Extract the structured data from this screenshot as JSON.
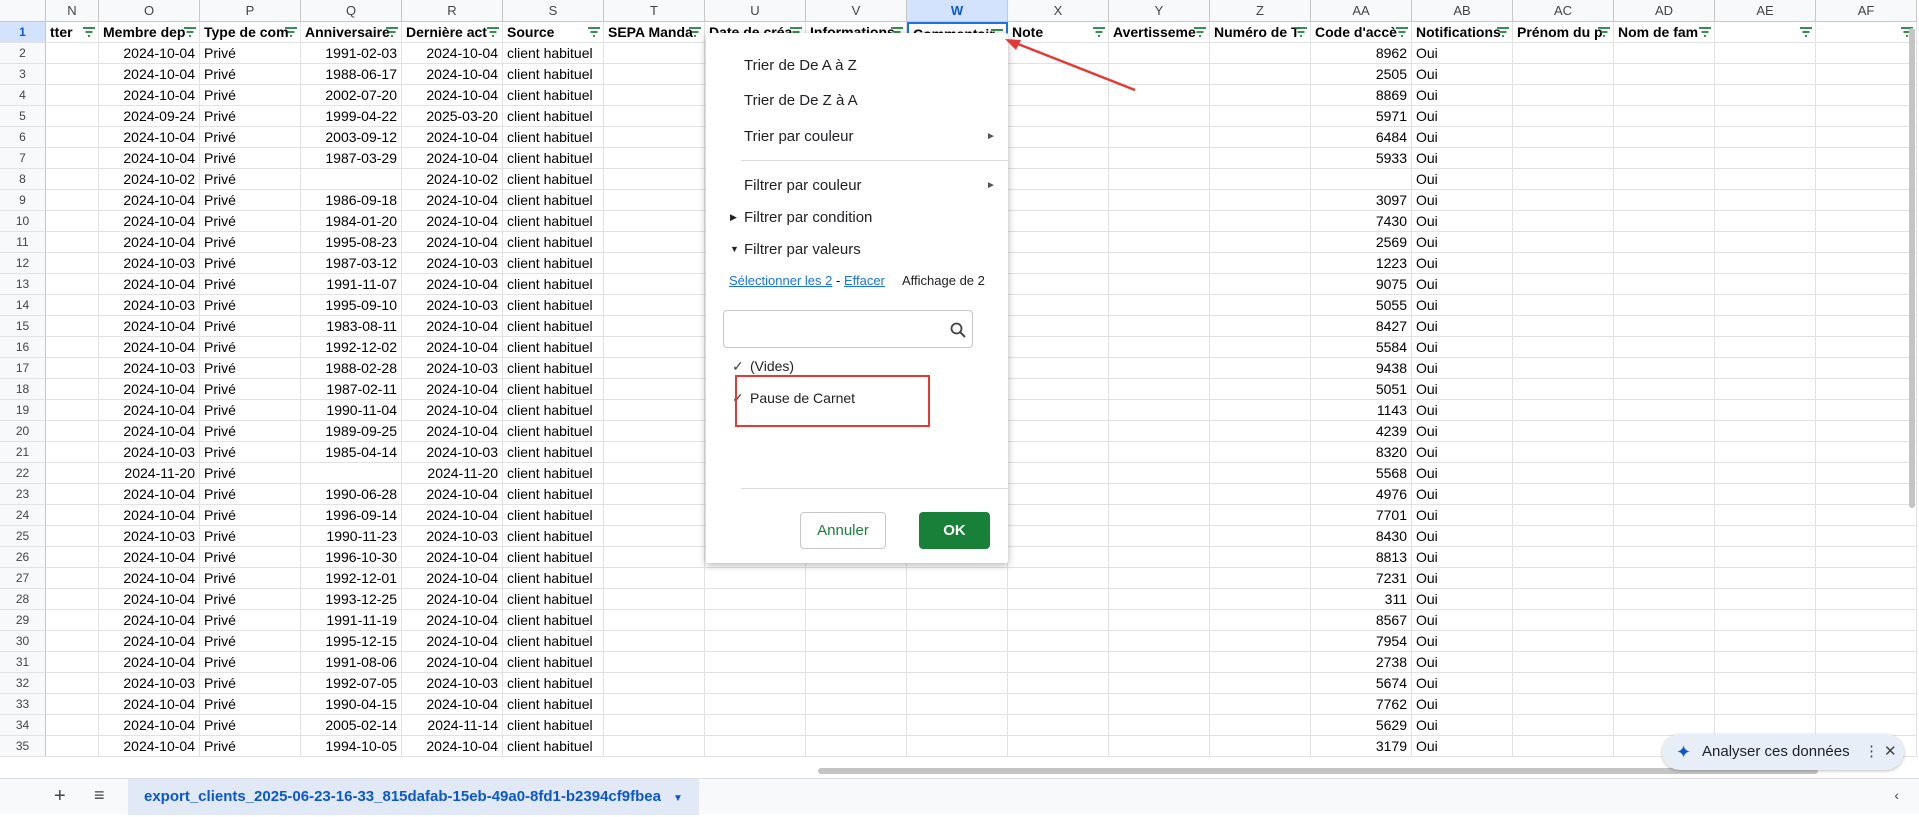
{
  "columns": [
    {
      "letter": "N",
      "w": 53,
      "header": "tter"
    },
    {
      "letter": "O",
      "w": 101,
      "header": "Membre dep"
    },
    {
      "letter": "P",
      "w": 101,
      "header": "Type de com"
    },
    {
      "letter": "Q",
      "w": 101,
      "header": "Anniversaire"
    },
    {
      "letter": "R",
      "w": 101,
      "header": "Dernière act"
    },
    {
      "letter": "S",
      "w": 101,
      "header": "Source"
    },
    {
      "letter": "T",
      "w": 101,
      "header": "SEPA Manda"
    },
    {
      "letter": "U",
      "w": 101,
      "header": "Date de créa"
    },
    {
      "letter": "V",
      "w": 101,
      "header": "Informations"
    },
    {
      "letter": "W",
      "w": 101,
      "header": "Commentair",
      "selected": true
    },
    {
      "letter": "X",
      "w": 101,
      "header": "Note"
    },
    {
      "letter": "Y",
      "w": 101,
      "header": "Avertisseme"
    },
    {
      "letter": "Z",
      "w": 101,
      "header": "Numéro de T"
    },
    {
      "letter": "AA",
      "w": 101,
      "header": "Code d'accè"
    },
    {
      "letter": "AB",
      "w": 101,
      "header": "Notifications"
    },
    {
      "letter": "AC",
      "w": 101,
      "header": "Prénom du p"
    },
    {
      "letter": "AD",
      "w": 101,
      "header": "Nom de fam"
    },
    {
      "letter": "AE",
      "w": 101,
      "header": ""
    },
    {
      "letter": "AF",
      "w": 101,
      "header": ""
    }
  ],
  "rows": [
    [
      "2",
      "2024-10-04",
      "Privé",
      "1991-02-03",
      "2024-10-04",
      "client habituel",
      "8962",
      "Oui"
    ],
    [
      "3",
      "2024-10-04",
      "Privé",
      "1988-06-17",
      "2024-10-04",
      "client habituel",
      "2505",
      "Oui"
    ],
    [
      "4",
      "2024-10-04",
      "Privé",
      "2002-07-20",
      "2024-10-04",
      "client habituel",
      "8869",
      "Oui"
    ],
    [
      "5",
      "2024-09-24",
      "Privé",
      "1999-04-22",
      "2025-03-20",
      "client habituel",
      "5971",
      "Oui"
    ],
    [
      "6",
      "2024-10-04",
      "Privé",
      "2003-09-12",
      "2024-10-04",
      "client habituel",
      "6484",
      "Oui"
    ],
    [
      "7",
      "2024-10-04",
      "Privé",
      "1987-03-29",
      "2024-10-04",
      "client habituel",
      "5933",
      "Oui"
    ],
    [
      "8",
      "2024-10-02",
      "Privé",
      "",
      "2024-10-02",
      "client habituel",
      "",
      "Oui"
    ],
    [
      "9",
      "2024-10-04",
      "Privé",
      "1986-09-18",
      "2024-10-04",
      "client habituel",
      "3097",
      "Oui"
    ],
    [
      "10",
      "2024-10-04",
      "Privé",
      "1984-01-20",
      "2024-10-04",
      "client habituel",
      "7430",
      "Oui"
    ],
    [
      "11",
      "2024-10-04",
      "Privé",
      "1995-08-23",
      "2024-10-04",
      "client habituel",
      "2569",
      "Oui"
    ],
    [
      "12",
      "2024-10-03",
      "Privé",
      "1987-03-12",
      "2024-10-03",
      "client habituel",
      "1223",
      "Oui"
    ],
    [
      "13",
      "2024-10-04",
      "Privé",
      "1991-11-07",
      "2024-10-04",
      "client habituel",
      "9075",
      "Oui"
    ],
    [
      "14",
      "2024-10-03",
      "Privé",
      "1995-09-10",
      "2024-10-03",
      "client habituel",
      "5055",
      "Oui"
    ],
    [
      "15",
      "2024-10-04",
      "Privé",
      "1983-08-11",
      "2024-10-04",
      "client habituel",
      "8427",
      "Oui"
    ],
    [
      "16",
      "2024-10-04",
      "Privé",
      "1992-12-02",
      "2024-10-04",
      "client habituel",
      "5584",
      "Oui"
    ],
    [
      "17",
      "2024-10-03",
      "Privé",
      "1988-02-28",
      "2024-10-03",
      "client habituel",
      "9438",
      "Oui"
    ],
    [
      "18",
      "2024-10-04",
      "Privé",
      "1987-02-11",
      "2024-10-04",
      "client habituel",
      "5051",
      "Oui"
    ],
    [
      "19",
      "2024-10-04",
      "Privé",
      "1990-11-04",
      "2024-10-04",
      "client habituel",
      "1143",
      "Oui"
    ],
    [
      "20",
      "2024-10-04",
      "Privé",
      "1989-09-25",
      "2024-10-04",
      "client habituel",
      "4239",
      "Oui"
    ],
    [
      "21",
      "2024-10-03",
      "Privé",
      "1985-04-14",
      "2024-10-03",
      "client habituel",
      "8320",
      "Oui"
    ],
    [
      "22",
      "2024-11-20",
      "Privé",
      "",
      "2024-11-20",
      "client habituel",
      "5568",
      "Oui"
    ],
    [
      "23",
      "2024-10-04",
      "Privé",
      "1990-06-28",
      "2024-10-04",
      "client habituel",
      "4976",
      "Oui"
    ],
    [
      "24",
      "2024-10-04",
      "Privé",
      "1996-09-14",
      "2024-10-04",
      "client habituel",
      "7701",
      "Oui"
    ],
    [
      "25",
      "2024-10-03",
      "Privé",
      "1990-11-23",
      "2024-10-03",
      "client habituel",
      "8430",
      "Oui"
    ],
    [
      "26",
      "2024-10-04",
      "Privé",
      "1996-10-30",
      "2024-10-04",
      "client habituel",
      "8813",
      "Oui"
    ],
    [
      "27",
      "2024-10-04",
      "Privé",
      "1992-12-01",
      "2024-10-04",
      "client habituel",
      "7231",
      "Oui"
    ],
    [
      "28",
      "2024-10-04",
      "Privé",
      "1993-12-25",
      "2024-10-04",
      "client habituel",
      "311",
      "Oui"
    ],
    [
      "29",
      "2024-10-04",
      "Privé",
      "1991-11-19",
      "2024-10-04",
      "client habituel",
      "8567",
      "Oui"
    ],
    [
      "30",
      "2024-10-04",
      "Privé",
      "1995-12-15",
      "2024-10-04",
      "client habituel",
      "7954",
      "Oui"
    ],
    [
      "31",
      "2024-10-04",
      "Privé",
      "1991-08-06",
      "2024-10-04",
      "client habituel",
      "2738",
      "Oui"
    ],
    [
      "32",
      "2024-10-03",
      "Privé",
      "1992-07-05",
      "2024-10-03",
      "client habituel",
      "5674",
      "Oui"
    ],
    [
      "33",
      "2024-10-04",
      "Privé",
      "1990-04-15",
      "2024-10-04",
      "client habituel",
      "7762",
      "Oui"
    ],
    [
      "34",
      "2024-10-04",
      "Privé",
      "2005-02-14",
      "2024-11-14",
      "client habituel",
      "5629",
      "Oui"
    ],
    [
      "35",
      "2024-10-04",
      "Privé",
      "1994-10-05",
      "2024-10-04",
      "client habituel",
      "3179",
      "Oui"
    ]
  ],
  "menu": {
    "sort_az": "Trier de De A à Z",
    "sort_za": "Trier de De Z à A",
    "sort_color": "Trier par couleur",
    "filter_color": "Filtrer par couleur",
    "filter_condition": "Filtrer par condition",
    "filter_values": "Filtrer par valeurs",
    "select_all": "Sélectionner les 2",
    "dash": "-",
    "clear": "Effacer",
    "display": "Affichage de 2",
    "search_placeholder": "",
    "values": [
      "(Vides)",
      "Pause de Carnet"
    ],
    "cancel": "Annuler",
    "ok": "OK"
  },
  "sheet_tab": "export_clients_2025-06-23-16-33_815dafab-15eb-49a0-8fd1-b2394cf9fbea",
  "analyze": "Analyser ces données",
  "first_row_num": "1"
}
